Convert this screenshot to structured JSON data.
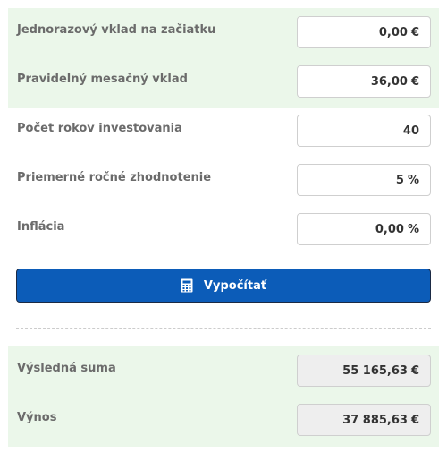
{
  "form": {
    "rows": [
      {
        "label": "Jednorazový vklad na začiatku",
        "value": "0,00",
        "unit": "€"
      },
      {
        "label": "Pravidelný mesačný vklad",
        "value": "36,00",
        "unit": "€"
      },
      {
        "label": "Počet rokov investovania",
        "value": "40",
        "unit": ""
      },
      {
        "label": "Priemerné ročné zhodnotenie",
        "value": "5",
        "unit": "%"
      },
      {
        "label": "Inflácia",
        "value": "0,00",
        "unit": "%"
      }
    ],
    "calculate_label": "Vypočítať"
  },
  "results": {
    "rows": [
      {
        "label": "Výsledná suma",
        "value": "55 165,63",
        "unit": "€"
      },
      {
        "label": "Výnos",
        "value": "37 885,63",
        "unit": "€"
      }
    ]
  },
  "colors": {
    "accent": "#0c5cb8",
    "highlight_background": "#ebf7ea",
    "readonly_background": "#eeeeee",
    "label_text": "#6b6b6b"
  },
  "icons": {
    "calculate": "calculator-icon"
  }
}
